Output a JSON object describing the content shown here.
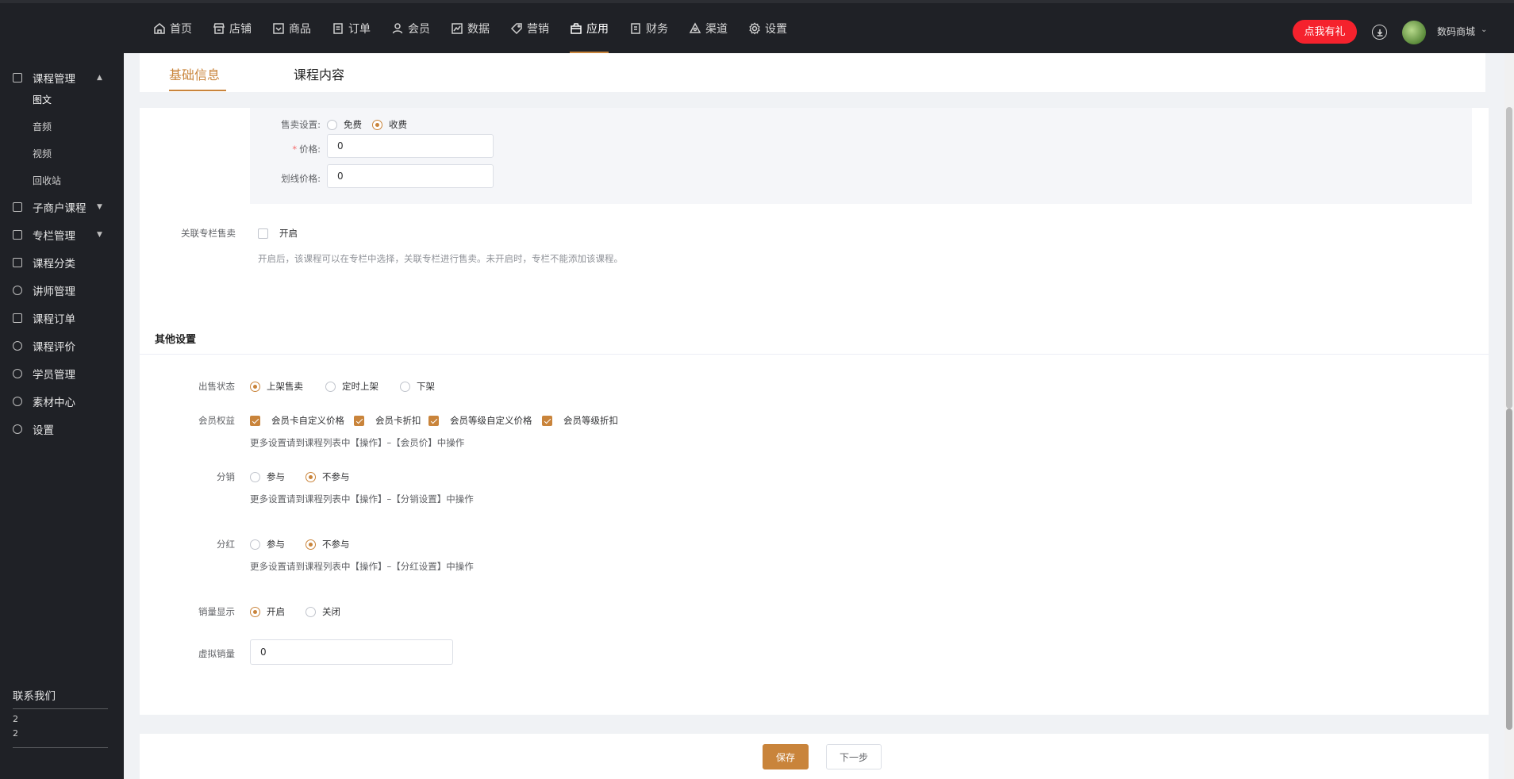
{
  "topnav": {
    "items": [
      {
        "label": "首页",
        "icon": "home-icon"
      },
      {
        "label": "店铺",
        "icon": "store-icon"
      },
      {
        "label": "商品",
        "icon": "goods-icon"
      },
      {
        "label": "订单",
        "icon": "order-icon"
      },
      {
        "label": "会员",
        "icon": "user-icon"
      },
      {
        "label": "数据",
        "icon": "chart-icon"
      },
      {
        "label": "营销",
        "icon": "tag-icon"
      },
      {
        "label": "应用",
        "icon": "app-icon",
        "active": true
      },
      {
        "label": "财务",
        "icon": "finance-icon"
      },
      {
        "label": "渠道",
        "icon": "channel-icon"
      },
      {
        "label": "设置",
        "icon": "gear-icon"
      }
    ],
    "gift_label": "点我有礼",
    "shop_name": "数码商城"
  },
  "sidebar": {
    "items": [
      {
        "label": "课程管理",
        "caret": "▲"
      },
      {
        "label": "子商户课程",
        "caret": "▼"
      },
      {
        "label": "专栏管理",
        "caret": "▼"
      },
      {
        "label": "课程分类"
      },
      {
        "label": "讲师管理"
      },
      {
        "label": "课程订单"
      },
      {
        "label": "课程评价"
      },
      {
        "label": "学员管理"
      },
      {
        "label": "素材中心"
      },
      {
        "label": "设置"
      }
    ],
    "subitems": [
      "图文",
      "音频",
      "视频",
      "回收站"
    ],
    "contact_title": "联系我们",
    "contact_values": [
      "2",
      "2"
    ]
  },
  "tabs": [
    "基础信息",
    "课程内容"
  ],
  "sale": {
    "label": "售卖设置:",
    "options": [
      "免费",
      "收费"
    ],
    "selected": "收费",
    "price_label": "价格:",
    "price_value": "0",
    "strike_label": "划线价格:",
    "strike_value": "0"
  },
  "column": {
    "label": "关联专栏售卖",
    "option": "开启",
    "hint": "开启后，该课程可以在专栏中选择，关联专栏进行售卖。未开启时，专栏不能添加该课程。"
  },
  "other": {
    "title": "其他设置",
    "status_label": "出售状态",
    "status_options": [
      "上架售卖",
      "定时上架",
      "下架"
    ],
    "member_label": "会员权益",
    "member_options": [
      "会员卡自定义价格",
      "会员卡折扣",
      "会员等级自定义价格",
      "会员等级折扣"
    ],
    "member_tip": "更多设置请到课程列表中【操作】–【会员价】中操作",
    "dist_label": "分销",
    "dist_options": [
      "参与",
      "不参与"
    ],
    "dist_tip": "更多设置请到课程列表中【操作】–【分销设置】中操作",
    "bonus_label": "分红",
    "bonus_options": [
      "参与",
      "不参与"
    ],
    "bonus_tip": "更多设置请到课程列表中【操作】–【分红设置】中操作",
    "sales_label": "销量显示",
    "sales_options": [
      "开启",
      "关闭"
    ],
    "virtual_label": "虚拟销量",
    "virtual_value": "0"
  },
  "footer": {
    "save": "保存",
    "next": "下一步"
  },
  "colors": {
    "accent": "#c9843b",
    "gift": "#f5222d",
    "nav_bg": "#1f2126"
  }
}
